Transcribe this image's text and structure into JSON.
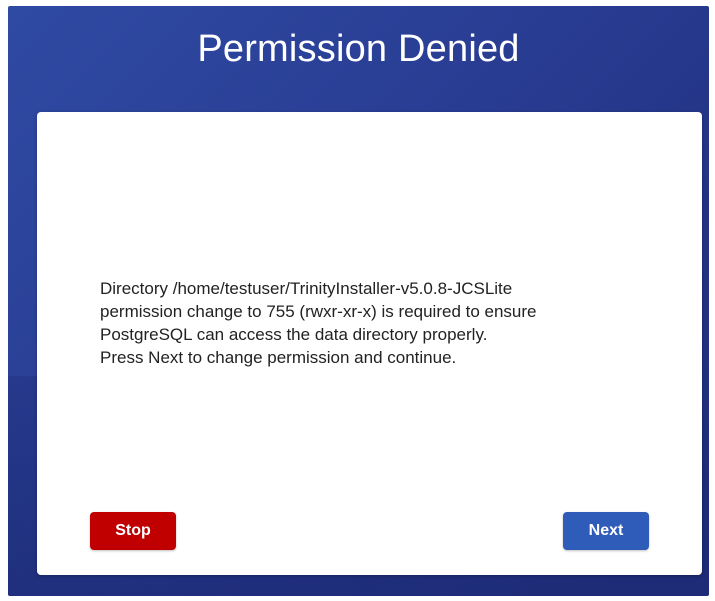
{
  "dialog": {
    "title": "Permission Denied",
    "message_lines": [
      "Directory /home/testuser/TrinityInstaller-v5.0.8-JCSLite",
      "permission change to 755 (rwxr-xr-x) is required to ensure",
      "PostgreSQL can access the data directory properly.",
      "Press Next to change permission and continue."
    ],
    "buttons": {
      "stop_label": "Stop",
      "next_label": "Next"
    }
  },
  "colors": {
    "background": "#2a3f96",
    "stop_button": "#c00000",
    "next_button": "#2f5cb8"
  }
}
